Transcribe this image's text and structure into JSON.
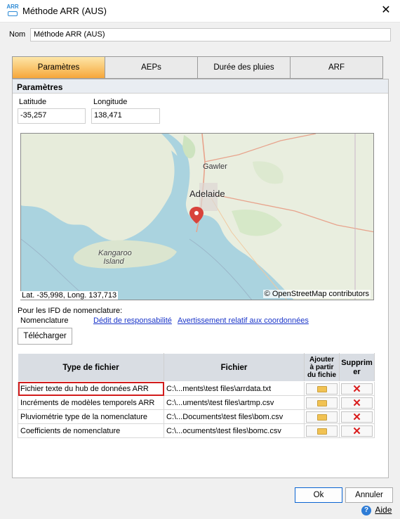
{
  "window": {
    "app_icon_text": "ARR",
    "title": "Méthode ARR (AUS)",
    "close_symbol": "✕"
  },
  "nom": {
    "label": "Nom",
    "value": "Méthode ARR (AUS)"
  },
  "tabs": [
    {
      "label": "Paramètres",
      "active": true
    },
    {
      "label": "AEPs",
      "active": false
    },
    {
      "label": "Durée des pluies",
      "active": false
    },
    {
      "label": "ARF",
      "active": false
    }
  ],
  "params": {
    "header": "Paramètres",
    "latitude_label": "Latitude",
    "latitude_value": "-35,257",
    "longitude_label": "Longitude",
    "longitude_value": "138,471"
  },
  "map": {
    "labels": {
      "gawler": "Gawler",
      "adelaide": "Adelaide",
      "kangaroo": "Kangaroo",
      "island": "Island"
    },
    "attribution": "© OpenStreetMap contributors",
    "cursor_coords": "Lat. -35,998, Long. 137,713"
  },
  "ifd": {
    "intro": "Pour les IFD de nomenclature:",
    "nomenclature_label": "Nomenclature",
    "disclaimer_link": "Dédit de responsabilité",
    "coords_warning_link": "Avertissement relatif aux coordonnées",
    "download_button": "Télécharger"
  },
  "table": {
    "headers": {
      "type": "Type de fichier",
      "file": "Fichier",
      "add_line1": "Ajouter",
      "add_line2": "à partir",
      "add_line3": "du fichie",
      "delete_line1": "Supprim",
      "delete_line2": "er"
    },
    "rows": [
      {
        "type": "Fichier texte du hub de données ARR",
        "file": "C:\\...ments\\test files\\arrdata.txt",
        "selected": true
      },
      {
        "type": "Incréments de modèles temporels ARR",
        "file": "C:\\...uments\\test files\\artmp.csv",
        "selected": false
      },
      {
        "type": "Pluviométrie type de la nomenclature",
        "file": "C:\\...Documents\\test files\\bom.csv",
        "selected": false
      },
      {
        "type": "Coefficients de nomenclature",
        "file": "C:\\...ocuments\\test files\\bomc.csv",
        "selected": false
      }
    ],
    "add_icon": "folder-icon",
    "delete_icon": "delete-x-icon"
  },
  "footer": {
    "ok": "Ok",
    "cancel": "Annuler",
    "help": "Aide"
  },
  "colors": {
    "tab_active_top": "#fde6a8",
    "tab_active_bottom": "#f6a73a",
    "link": "#1a35c9",
    "selection_outline": "#d21c1c"
  }
}
